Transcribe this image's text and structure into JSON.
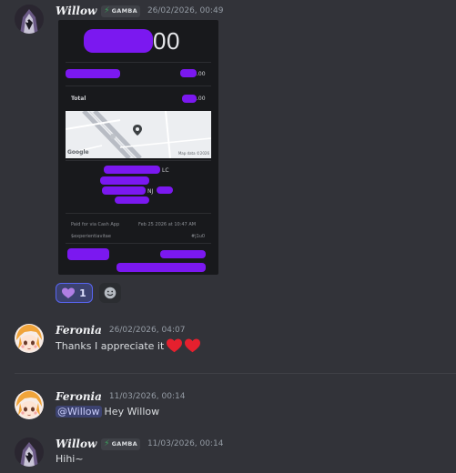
{
  "messages": [
    {
      "author": "Willow",
      "tag": "GAMBA",
      "timestamp": "26/02/2026, 00:49",
      "receipt": {
        "amount_suffix": "00",
        "line_suffix": ".00",
        "total_label": "Total",
        "total_suffix": ".00",
        "map_credit": "Google",
        "map_data_label": "Map data ©2026",
        "address_suffix": "LC",
        "state": "NJ",
        "paid_label": "Paid for via Cash App",
        "paid_date": "Feb 25 2026 at 10:47 AM",
        "cashtag": "$experientiavitae",
        "ref": "#j1u0"
      },
      "reactions": [
        {
          "emoji": "purple-heart",
          "count": "1"
        }
      ]
    },
    {
      "author": "Feronia",
      "timestamp": "26/02/2026, 04:07",
      "text": "Thanks I appreciate it"
    },
    {
      "author": "Feronia",
      "timestamp": "11/03/2026, 00:14",
      "mention": "@Willow",
      "text": "Hey Willow"
    },
    {
      "author": "Willow",
      "tag": "GAMBA",
      "timestamp": "11/03/2026, 00:14",
      "text": "Hihi~"
    }
  ],
  "colors": {
    "background": "#323339",
    "redaction": "#7b18f0",
    "heart": "#e5202e",
    "mention_bg": "#3c4270",
    "tag_icon": "#3ba55d"
  },
  "icons": [
    "willow-avatar",
    "feronia-avatar",
    "lightning-icon",
    "purple-heart-icon",
    "add-reaction-icon",
    "red-heart-icon",
    "map-pin-icon"
  ]
}
